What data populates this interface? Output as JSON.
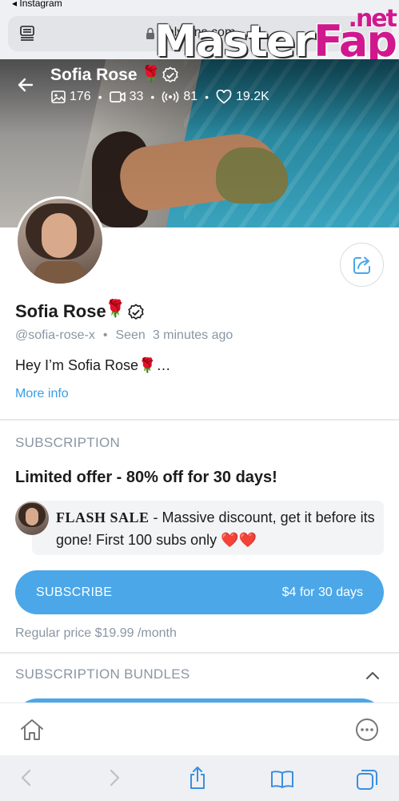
{
  "status": {
    "back_app": "◂ Instagram"
  },
  "address_bar": {
    "url": "onlyfans.com"
  },
  "watermark": {
    "master": "Master",
    "fap": "Fap",
    "net": ".net"
  },
  "profile": {
    "name": "Sofia Rose",
    "name_emoji": "🌹",
    "handle": "@sofia-rose-x",
    "seen_label": "Seen",
    "seen_time": "3 minutes ago",
    "bio": "Hey I’m Sofia Rose🌹…",
    "more_info": "More info",
    "stats": {
      "photos": "176",
      "videos": "33",
      "streams": "81",
      "likes": "19.2K"
    }
  },
  "subscription": {
    "section_label": "SUBSCRIPTION",
    "offer_title": "Limited offer - 80% off for 30 days!",
    "flash_title": "FLASH SALE",
    "flash_body": " - Massive discount, get it before its gone! First 100 subs only ❤️❤️",
    "subscribe_label": "SUBSCRIBE",
    "subscribe_price": "$4 for 30 days",
    "regular_price": "Regular price $19.99 /month"
  },
  "bundles": {
    "section_label": "SUBSCRIPTION BUNDLES"
  },
  "colors": {
    "accent": "#4ba7e8",
    "link": "#3a9ee4",
    "muted": "#8a96a3"
  }
}
